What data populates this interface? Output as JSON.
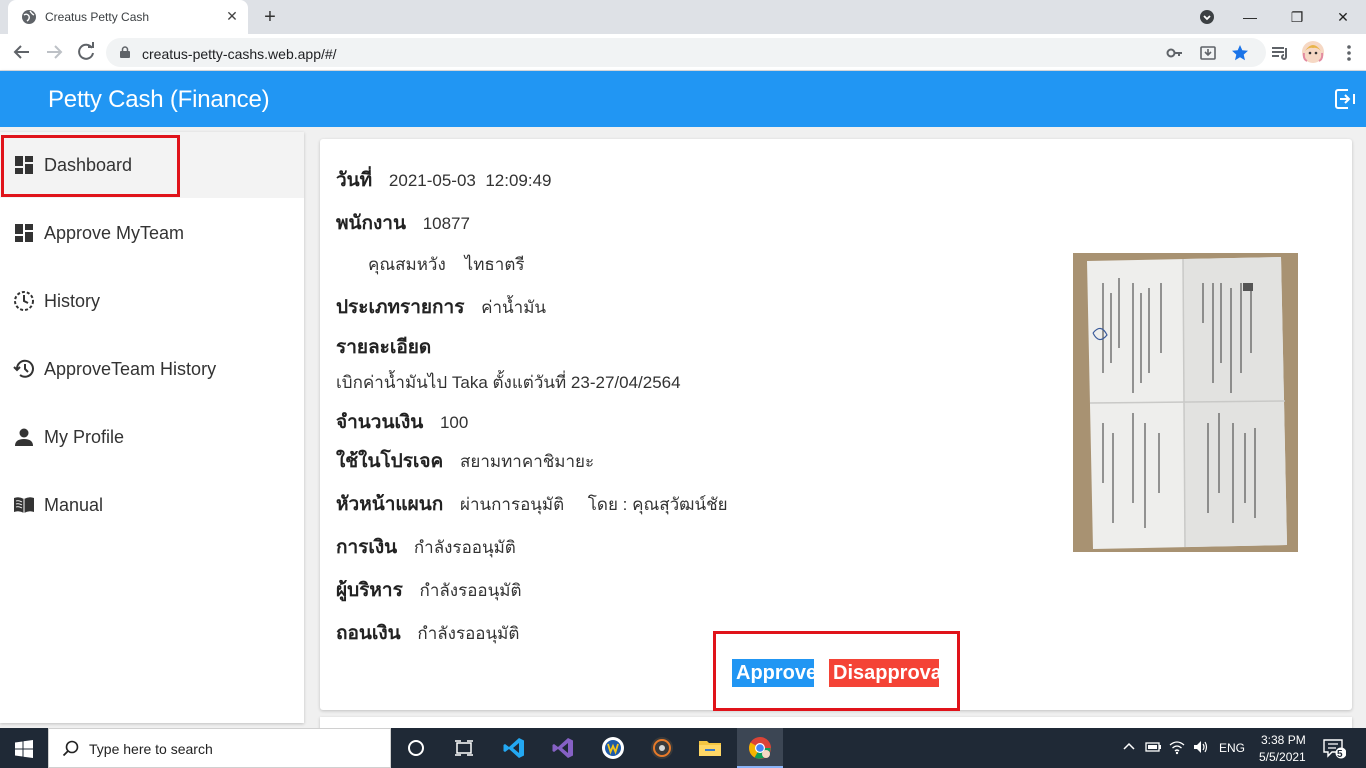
{
  "browser": {
    "tab_title": "Creatus Petty Cash",
    "tab_close": "✕",
    "new_tab": "+",
    "url": "creatus-petty-cashs.web.app/#/",
    "window_minimize": "—",
    "window_restore": "❐",
    "window_close": "✕"
  },
  "app": {
    "title": "Petty Cash (Finance)"
  },
  "sidebar": {
    "items": [
      {
        "label": "Dashboard",
        "icon": "dashboard-icon"
      },
      {
        "label": "Approve MyTeam",
        "icon": "dashboard-icon"
      },
      {
        "label": "History",
        "icon": "clock-icon"
      },
      {
        "label": "ApproveTeam History",
        "icon": "history-icon"
      },
      {
        "label": "My Profile",
        "icon": "person-icon"
      },
      {
        "label": "Manual",
        "icon": "book-icon"
      }
    ]
  },
  "detail": {
    "date_label": "วันที่",
    "date_value": "2021-05-03  12:09:49",
    "employee_label": "พนักงาน",
    "employee_id": "10877",
    "employee_name": "คุณสมหวัง    ไทธาตรี",
    "type_label": "ประเภทรายการ",
    "type_value": "ค่าน้ำมัน",
    "details_label": "รายละเอียด",
    "details_value": "เบิกค่าน้ำมันไป Taka ตั้งแต่วันที่ 23-27/04/2564",
    "amount_label": "จำนวนเงิน",
    "amount_value": "100",
    "project_label": "ใช้ในโปรเจค",
    "project_value": "สยามทาคาชิมายะ",
    "head_label": "หัวหน้าแผนก",
    "head_value": "ผ่านการอนุมัติ     โดย : คุณสุวัฒน์ชัย",
    "finance_label": "การเงิน",
    "finance_value": "กำลังรออนุมัติ",
    "exec_label": "ผู้บริหาร",
    "exec_value": "กำลังรออนุมัติ",
    "withdraw_label": "ถอนเงิน",
    "withdraw_value": "กำลังรออนุมัติ"
  },
  "actions": {
    "approve": "Approve",
    "disapprove": "Disapproval"
  },
  "taskbar": {
    "search_placeholder": "Type here to search",
    "language": "ENG",
    "time": "3:38 PM",
    "date": "5/5/2021",
    "notifications": "5"
  },
  "colors": {
    "appbar": "#2196f3",
    "approve": "#2196f3",
    "disapprove": "#f44336",
    "highlight": "#e0131a"
  }
}
